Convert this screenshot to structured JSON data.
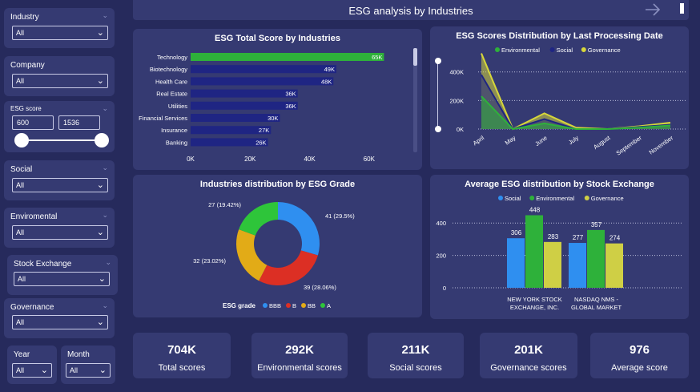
{
  "header": {
    "title": "ESG analysis by Industries"
  },
  "filters": {
    "industry": {
      "label": "Industry",
      "value": "All"
    },
    "company": {
      "label": "Company",
      "value": "All"
    },
    "esg_score": {
      "label": "ESG score",
      "min": "600",
      "max": "1536"
    },
    "social": {
      "label": "Social",
      "value": "All"
    },
    "environmental": {
      "label": "Enviromental",
      "value": "All"
    },
    "stock_exchange": {
      "label": "Stock Exchange",
      "value": "All"
    },
    "governance": {
      "label": "Governance",
      "value": "All"
    },
    "year": {
      "label": "Year",
      "value": "All"
    },
    "month": {
      "label": "Month",
      "value": "All"
    }
  },
  "charts": {
    "total_score": {
      "title": "ESG Total Score by Industries"
    },
    "processing_date": {
      "title": "ESG Scores Distribution by Last Processing Date"
    },
    "grade": {
      "title": "Industries distribution by ESG Grade"
    },
    "stock_exchange": {
      "title": "Average ESG distribution by Stock Exchange"
    }
  },
  "chart_data": [
    {
      "type": "bar",
      "orientation": "horizontal",
      "title": "ESG Total Score by Industries",
      "categories": [
        "Technology",
        "Biotechnology",
        "Health Care",
        "Real Estate",
        "Utilities",
        "Financial Services",
        "Insurance",
        "Banking"
      ],
      "values": [
        65000,
        49000,
        48000,
        36000,
        36000,
        30000,
        27000,
        26000
      ],
      "data_labels": [
        "65K",
        "49K",
        "48K",
        "36K",
        "36K",
        "30K",
        "27K",
        "26K"
      ],
      "xticks": [
        "0K",
        "20K",
        "40K",
        "60K"
      ],
      "xlim": [
        0,
        70000
      ],
      "highlight_color": "#2eb13a",
      "bar_color": "#1f2583"
    },
    {
      "type": "area",
      "title": "ESG Scores Distribution by Last Processing Date",
      "x": [
        "April",
        "May",
        "June",
        "July",
        "August",
        "September",
        "November"
      ],
      "series": [
        {
          "name": "Environmental",
          "color": "#2eb13a",
          "values": [
            230000,
            0,
            40000,
            0,
            0,
            10000,
            25000
          ]
        },
        {
          "name": "Social",
          "color": "#1f2583",
          "values": [
            380000,
            0,
            70000,
            0,
            0,
            15000,
            30000
          ]
        },
        {
          "name": "Governance",
          "color": "#d6d63a",
          "values": [
            530000,
            0,
            110000,
            10000,
            0,
            20000,
            45000
          ]
        }
      ],
      "yticks": [
        "0K",
        "200K",
        "400K"
      ],
      "ylim": [
        0,
        550000
      ],
      "legend": "top"
    },
    {
      "type": "pie",
      "title": "Industries distribution by ESG Grade",
      "legend_title": "ESG grade",
      "slices": [
        {
          "name": "BBB",
          "value": 41,
          "label": "41 (29.5%)",
          "color": "#2f8ff0"
        },
        {
          "name": "B",
          "value": 39,
          "label": "39 (28.06%)",
          "color": "#dc2f24"
        },
        {
          "name": "BB",
          "value": 32,
          "label": "32 (23.02%)",
          "color": "#e2ab17"
        },
        {
          "name": "A",
          "value": 27,
          "label": "27 (19.42%)",
          "color": "#2ec53a"
        }
      ]
    },
    {
      "type": "bar",
      "title": "Average ESG distribution by Stock Exchange",
      "categories": [
        "NEW YORK STOCK EXCHANGE, INC.",
        "NASDAQ NMS - GLOBAL MARKET"
      ],
      "series": [
        {
          "name": "Social",
          "color": "#2f8ff0",
          "values": [
            306,
            277
          ]
        },
        {
          "name": "Environmental",
          "color": "#2eb13a",
          "values": [
            448,
            357
          ]
        },
        {
          "name": "Governance",
          "color": "#cfcf45",
          "values": [
            283,
            274
          ]
        }
      ],
      "yticks": [
        "0",
        "200",
        "400"
      ],
      "ylim": [
        0,
        500
      ],
      "legend": "top"
    }
  ],
  "kpis": [
    {
      "value": "704K",
      "label": "Total scores"
    },
    {
      "value": "292K",
      "label": "Environmental scores"
    },
    {
      "value": "211K",
      "label": "Social scores"
    },
    {
      "value": "201K",
      "label": "Governance scores"
    },
    {
      "value": "976",
      "label": "Average score"
    }
  ]
}
